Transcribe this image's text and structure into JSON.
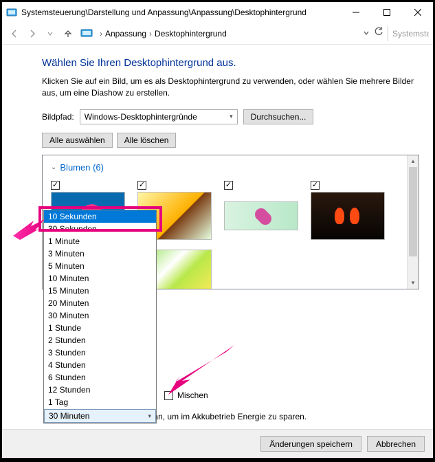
{
  "titlebar": {
    "title": "Systemsteuerung\\Darstellung und Anpassung\\Anpassung\\Desktophintergrund"
  },
  "breadcrumb": {
    "seg1": "Anpassung",
    "seg2": "Desktophintergrund"
  },
  "search": {
    "placeholder": "Systemste"
  },
  "page": {
    "title": "Wählen Sie Ihren Desktophintergrund aus.",
    "desc": "Klicken Sie auf ein Bild, um es als Desktophintergrund zu verwenden, oder wählen Sie mehrere Bilder aus, um eine Diashow zu erstellen."
  },
  "imagepath": {
    "label": "Bildpfad:",
    "value": "Windows-Desktophintergründe",
    "browse": "Durchsuchen..."
  },
  "toolbar": {
    "select_all": "Alle auswählen",
    "clear_all": "Alle löschen"
  },
  "group": {
    "header": "Blumen (6)"
  },
  "interval": {
    "options": [
      "10 Sekunden",
      "30 Sekunden",
      "1 Minute",
      "3 Minuten",
      "5 Minuten",
      "10 Minuten",
      "15 Minuten",
      "20 Minuten",
      "30 Minuten",
      "1 Stunde",
      "2 Stunden",
      "3 Stunden",
      "4 Stunden",
      "6 Stunden",
      "12 Stunden",
      "1 Tag"
    ],
    "selected": "30 Minuten"
  },
  "shuffle": {
    "label": "Mischen"
  },
  "energy": {
    "label": "Halten Sie die Diashow an, um im Akkubetrieb Energie zu sparen."
  },
  "footer": {
    "save": "Änderungen speichern",
    "cancel": "Abbrechen"
  }
}
